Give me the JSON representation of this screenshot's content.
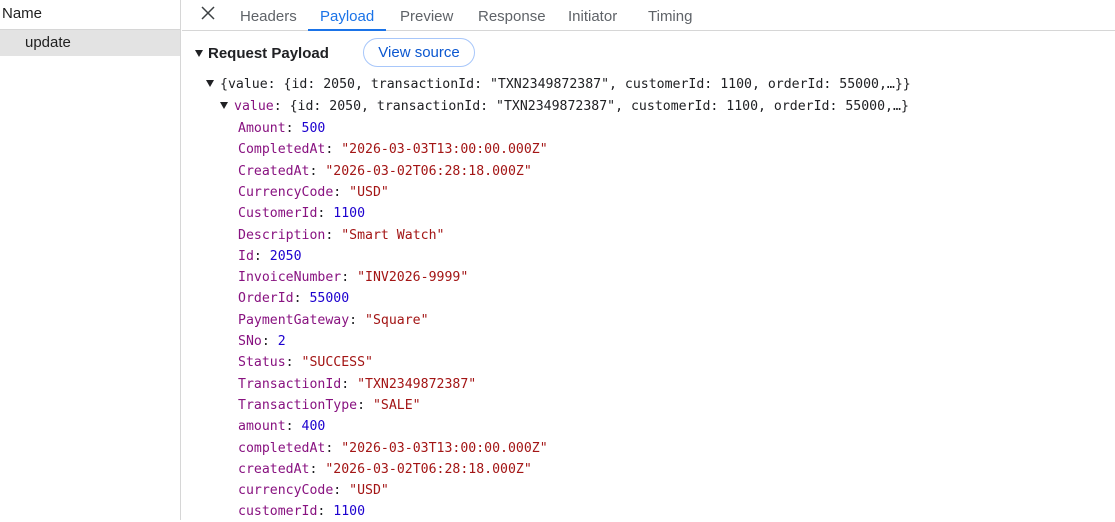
{
  "left_panel": {
    "header": "Name",
    "items": [
      {
        "label": "update"
      }
    ]
  },
  "tabs": [
    {
      "label": "Headers",
      "active": false
    },
    {
      "label": "Payload",
      "active": true
    },
    {
      "label": "Preview",
      "active": false
    },
    {
      "label": "Response",
      "active": false
    },
    {
      "label": "Initiator",
      "active": false
    },
    {
      "label": "Timing",
      "active": false
    }
  ],
  "payload": {
    "section_title": "Request Payload",
    "view_source_label": "View source",
    "root_summary": "{value: {id: 2050, transactionId: \"TXN2349872387\", customerId: 1100, orderId: 55000,…}}",
    "value_key": "value",
    "value_summary": "{id: 2050, transactionId: \"TXN2349872387\", customerId: 1100, orderId: 55000,…}",
    "properties": [
      {
        "key": "Amount",
        "value": "500",
        "type": "number"
      },
      {
        "key": "CompletedAt",
        "value": "\"2026-03-03T13:00:00.000Z\"",
        "type": "string"
      },
      {
        "key": "CreatedAt",
        "value": "\"2026-03-02T06:28:18.000Z\"",
        "type": "string"
      },
      {
        "key": "CurrencyCode",
        "value": "\"USD\"",
        "type": "string"
      },
      {
        "key": "CustomerId",
        "value": "1100",
        "type": "number"
      },
      {
        "key": "Description",
        "value": "\"Smart Watch\"",
        "type": "string"
      },
      {
        "key": "Id",
        "value": "2050",
        "type": "number"
      },
      {
        "key": "InvoiceNumber",
        "value": "\"INV2026-9999\"",
        "type": "string"
      },
      {
        "key": "OrderId",
        "value": "55000",
        "type": "number"
      },
      {
        "key": "PaymentGateway",
        "value": "\"Square\"",
        "type": "string"
      },
      {
        "key": "SNo",
        "value": "2",
        "type": "number"
      },
      {
        "key": "Status",
        "value": "\"SUCCESS\"",
        "type": "string"
      },
      {
        "key": "TransactionId",
        "value": "\"TXN2349872387\"",
        "type": "string"
      },
      {
        "key": "TransactionType",
        "value": "\"SALE\"",
        "type": "string"
      },
      {
        "key": "amount",
        "value": "400",
        "type": "number"
      },
      {
        "key": "completedAt",
        "value": "\"2026-03-03T13:00:00.000Z\"",
        "type": "string"
      },
      {
        "key": "createdAt",
        "value": "\"2026-03-02T06:28:18.000Z\"",
        "type": "string"
      },
      {
        "key": "currencyCode",
        "value": "\"USD\"",
        "type": "string"
      },
      {
        "key": "customerId",
        "value": "1100",
        "type": "number"
      }
    ]
  },
  "colors": {
    "accent": "#1a73e8",
    "key": "#881280",
    "number": "#1c00cf",
    "string": "#a31515"
  }
}
